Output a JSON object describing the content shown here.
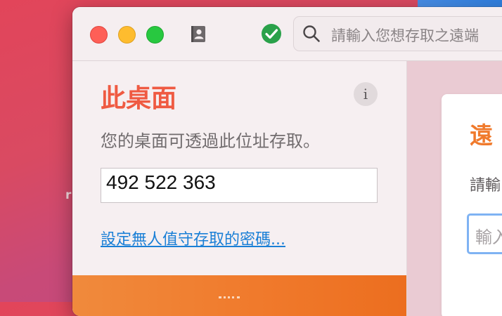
{
  "desktop": {
    "partial_char": "r"
  },
  "window": {
    "search": {
      "placeholder": "請輸入您想存取之遠端"
    },
    "this_desk": {
      "title": "此桌面",
      "info_glyph": "i",
      "description": "您的桌面可透過此位址存取。",
      "address": "492 522 363",
      "unattended_link": "設定無人值守存取的密碼..."
    },
    "remote_desk": {
      "title_partial": "遠",
      "subtitle_partial": "請輸",
      "input_placeholder_partial": "輸入"
    }
  },
  "colors": {
    "accent_red": "#ef5a42",
    "accent_orange": "#f07a2c",
    "link_blue": "#1a7fd6",
    "status_green": "#2aa14a"
  }
}
